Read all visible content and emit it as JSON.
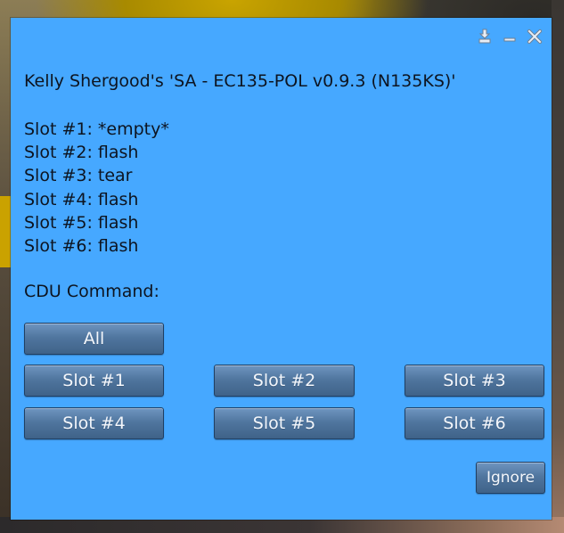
{
  "dialog": {
    "title": "Kelly Shergood's 'SA - EC135-POL v0.9.3 (N135KS)'",
    "controls": [
      {
        "name": "dock-icon"
      },
      {
        "name": "minimize-icon"
      },
      {
        "name": "close-icon"
      }
    ],
    "slots": [
      {
        "label": "Slot #1: *empty*"
      },
      {
        "label": "Slot #2: flash"
      },
      {
        "label": "Slot #3: tear"
      },
      {
        "label": "Slot #4: flash"
      },
      {
        "label": "Slot #5: flash"
      },
      {
        "label": "Slot #6: flash"
      }
    ],
    "cdu_label": "CDU Command:",
    "buttons": {
      "all": "All",
      "slot1": "Slot #1",
      "slot2": "Slot #2",
      "slot3": "Slot #3",
      "slot4": "Slot #4",
      "slot5": "Slot #5",
      "slot6": "Slot #6",
      "ignore": "Ignore"
    },
    "colors": {
      "dialog_bg": "#46a8ff",
      "button_bg": "#50769f",
      "text": "#0d1420"
    }
  }
}
